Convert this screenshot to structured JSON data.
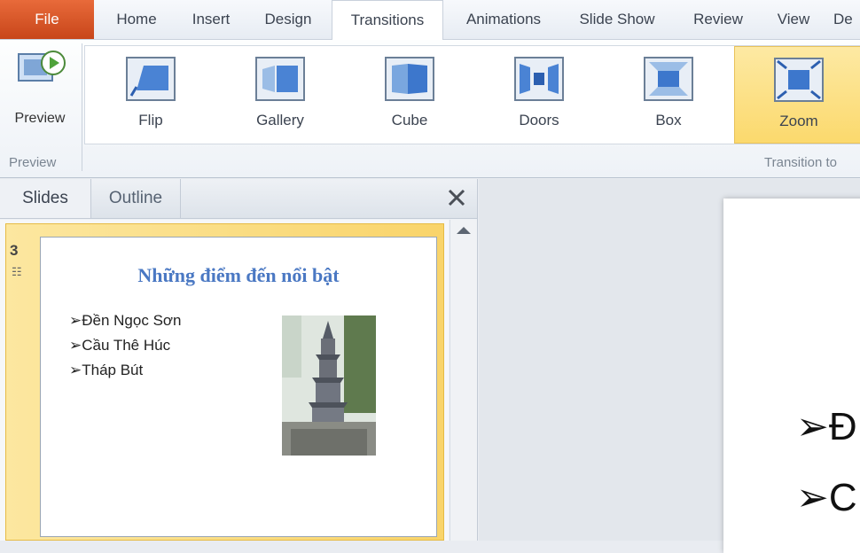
{
  "ribbon_tabs": {
    "file": "File",
    "home": "Home",
    "insert": "Insert",
    "design": "Design",
    "transitions": "Transitions",
    "animations": "Animations",
    "slide_show": "Slide Show",
    "review": "Review",
    "view": "View",
    "partial": "De"
  },
  "preview_group": {
    "button_label": "Preview",
    "group_label": "Preview"
  },
  "transition_group": {
    "group_label": "Transition to"
  },
  "effects": {
    "flip": "Flip",
    "gallery": "Gallery",
    "cube": "Cube",
    "doors": "Doors",
    "box": "Box",
    "zoom": "Zoom",
    "selected": "Zoom"
  },
  "pane": {
    "slides_tab": "Slides",
    "outline_tab": "Outline"
  },
  "slide": {
    "number": "3",
    "title": "Những điểm đến nổi bật",
    "bullets": [
      "➢Đền Ngọc Sơn",
      "➢Cầu Thê Húc",
      "➢Tháp Bút"
    ]
  },
  "main_slide": {
    "line1": "➢Đ",
    "line2": "➢C"
  },
  "colors": {
    "file_tab": "#d65426",
    "selected_effect": "#fbd96d",
    "slide_title": "#4a78c3"
  }
}
